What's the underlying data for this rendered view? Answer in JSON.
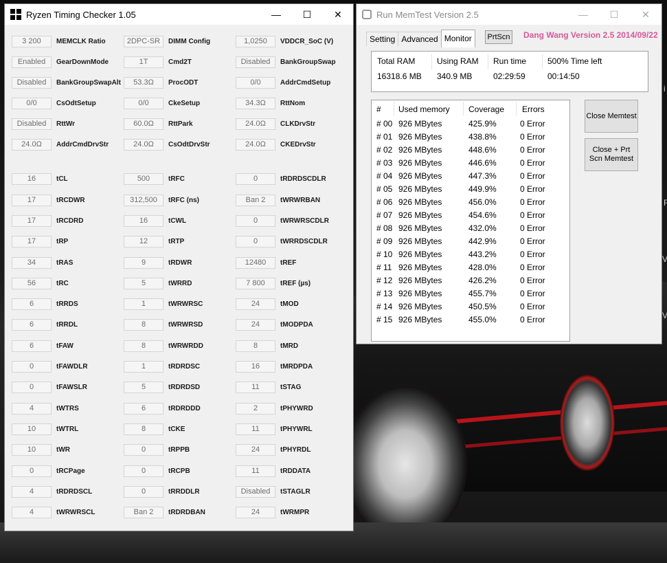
{
  "rtc": {
    "title": "Ryzen Timing Checker 1.05",
    "rows": [
      [
        [
          "3 200",
          "MEMCLK Ratio"
        ],
        [
          "2DPC-SR",
          "DIMM Config"
        ],
        [
          "1,0250",
          "VDDCR_SoC (V)"
        ]
      ],
      [
        [
          "Enabled",
          "GearDownMode"
        ],
        [
          "1T",
          "Cmd2T"
        ],
        [
          "Disabled",
          "BankGroupSwap"
        ]
      ],
      [
        [
          "Disabled",
          "BankGroupSwapAlt"
        ],
        [
          "53.3Ω",
          "ProcODT"
        ],
        [
          "0/0",
          "AddrCmdSetup"
        ]
      ],
      [
        [
          "0/0",
          "CsOdtSetup"
        ],
        [
          "0/0",
          "CkeSetup"
        ],
        [
          "34.3Ω",
          "RttNom"
        ]
      ],
      [
        [
          "Disabled",
          "RttWr"
        ],
        [
          "60.0Ω",
          "RttPark"
        ],
        [
          "24.0Ω",
          "CLKDrvStr"
        ]
      ],
      [
        [
          "24.0Ω",
          "AddrCmdDrvStr"
        ],
        [
          "24.0Ω",
          "CsOdtDrvStr"
        ],
        [
          "24.0Ω",
          "CKEDrvStr"
        ]
      ],
      [
        [
          "16",
          "tCL"
        ],
        [
          "500",
          "tRFC"
        ],
        [
          "0",
          "tRDRDSCDLR"
        ]
      ],
      [
        [
          "17",
          "tRCDWR"
        ],
        [
          "312,500",
          "tRFC (ns)"
        ],
        [
          "Ban 2",
          "tWRWRBAN"
        ]
      ],
      [
        [
          "17",
          "tRCDRD"
        ],
        [
          "16",
          "tCWL"
        ],
        [
          "0",
          "tWRWRSCDLR"
        ]
      ],
      [
        [
          "17",
          "tRP"
        ],
        [
          "12",
          "tRTP"
        ],
        [
          "0",
          "tWRRDSCDLR"
        ]
      ],
      [
        [
          "34",
          "tRAS"
        ],
        [
          "9",
          "tRDWR"
        ],
        [
          "12480",
          "tREF"
        ]
      ],
      [
        [
          "56",
          "tRC"
        ],
        [
          "5",
          "tWRRD"
        ],
        [
          "7 800",
          "tREF (µs)"
        ]
      ],
      [
        [
          "6",
          "tRRDS"
        ],
        [
          "1",
          "tWRWRSC"
        ],
        [
          "24",
          "tMOD"
        ]
      ],
      [
        [
          "6",
          "tRRDL"
        ],
        [
          "8",
          "tWRWRSD"
        ],
        [
          "24",
          "tMODPDA"
        ]
      ],
      [
        [
          "6",
          "tFAW"
        ],
        [
          "8",
          "tWRWRDD"
        ],
        [
          "8",
          "tMRD"
        ]
      ],
      [
        [
          "0",
          "tFAWDLR"
        ],
        [
          "1",
          "tRDRDSC"
        ],
        [
          "16",
          "tMRDPDA"
        ]
      ],
      [
        [
          "0",
          "tFAWSLR"
        ],
        [
          "5",
          "tRDRDSD"
        ],
        [
          "11",
          "tSTAG"
        ]
      ],
      [
        [
          "4",
          "tWTRS"
        ],
        [
          "6",
          "tRDRDDD"
        ],
        [
          "2",
          "tPHYWRD"
        ]
      ],
      [
        [
          "10",
          "tWTRL"
        ],
        [
          "8",
          "tCKE"
        ],
        [
          "11",
          "tPHYWRL"
        ]
      ],
      [
        [
          "10",
          "tWR"
        ],
        [
          "0",
          "tRPPB"
        ],
        [
          "24",
          "tPHYRDL"
        ]
      ],
      [
        [
          "0",
          "tRCPage"
        ],
        [
          "0",
          "tRCPB"
        ],
        [
          "11",
          "tRDDATA"
        ]
      ],
      [
        [
          "4",
          "tRDRDSCL"
        ],
        [
          "0",
          "tRRDDLR"
        ],
        [
          "Disabled",
          "tSTAGLR"
        ]
      ],
      [
        [
          "4",
          "tWRWRSCL"
        ],
        [
          "Ban 2",
          "tRDRDBAN"
        ],
        [
          "24",
          "tWRMPR"
        ]
      ]
    ]
  },
  "memtest": {
    "title": "Run MemTest Version 2.5",
    "tabs": [
      "Setting",
      "Advanced",
      "Monitor"
    ],
    "active_tab": "Monitor",
    "prtscn_label": "PrtScn",
    "version_text": "Dang Wang Version 2.5 2014/09/22",
    "stats": {
      "headers": [
        "Total RAM",
        "Using RAM",
        "Run time",
        "500% Time left"
      ],
      "values": [
        "16318.6 MB",
        "340.9 MB",
        "02:29:59",
        "00:14:50"
      ]
    },
    "list_headers": [
      "#",
      "Used memory",
      "Coverage",
      "Errors"
    ],
    "rows": [
      [
        "# 00",
        "926 MBytes",
        "425.9%",
        "0 Error"
      ],
      [
        "# 01",
        "926 MBytes",
        "438.8%",
        "0 Error"
      ],
      [
        "# 02",
        "926 MBytes",
        "448.6%",
        "0 Error"
      ],
      [
        "# 03",
        "926 MBytes",
        "446.6%",
        "0 Error"
      ],
      [
        "# 04",
        "926 MBytes",
        "447.3%",
        "0 Error"
      ],
      [
        "# 05",
        "926 MBytes",
        "449.9%",
        "0 Error"
      ],
      [
        "# 06",
        "926 MBytes",
        "456.0%",
        "0 Error"
      ],
      [
        "# 07",
        "926 MBytes",
        "454.6%",
        "0 Error"
      ],
      [
        "# 08",
        "926 MBytes",
        "432.0%",
        "0 Error"
      ],
      [
        "# 09",
        "926 MBytes",
        "442.9%",
        "0 Error"
      ],
      [
        "# 10",
        "926 MBytes",
        "443.2%",
        "0 Error"
      ],
      [
        "# 11",
        "926 MBytes",
        "428.0%",
        "0 Error"
      ],
      [
        "# 12",
        "926 MBytes",
        "426.2%",
        "0 Error"
      ],
      [
        "# 13",
        "926 MBytes",
        "455.7%",
        "0 Error"
      ],
      [
        "# 14",
        "926 MBytes",
        "450.5%",
        "0 Error"
      ],
      [
        "# 15",
        "926 MBytes",
        "455.0%",
        "0 Error"
      ]
    ],
    "close_button": "Close Memtest",
    "close_prt_line1": "Close +    Prt",
    "close_prt_line2": "Scn Memtest"
  },
  "window_controls": {
    "minimize": "—",
    "maximize": "☐",
    "close": "✕"
  },
  "edge_glyphs": [
    "i",
    "F",
    "V",
    "V"
  ],
  "icons": [
    "app-grid-icon",
    "gear-icon",
    "minimize-icon",
    "maximize-icon",
    "close-icon"
  ]
}
